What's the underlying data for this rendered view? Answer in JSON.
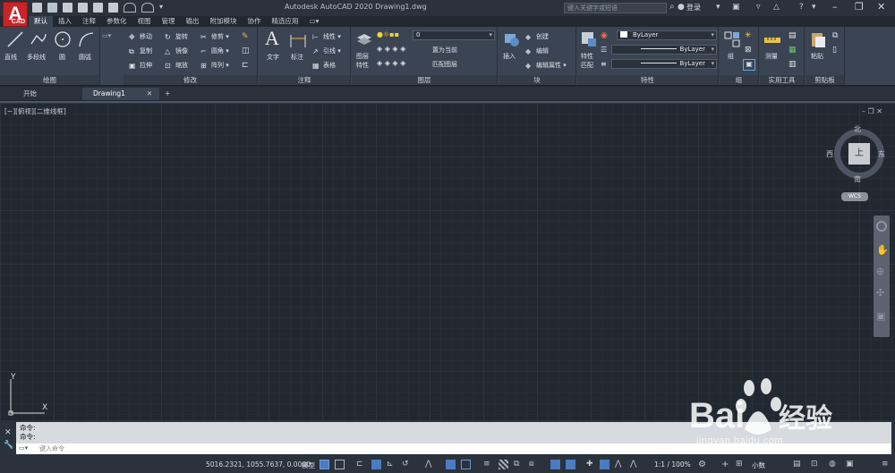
{
  "titlebar": {
    "app_title": "Autodesk AutoCAD 2020    Drawing1.dwg",
    "search_placeholder": "键入关键字或短语",
    "sign_in": "登录",
    "logo_letter": "A",
    "logo_sub": "CAD"
  },
  "ribbon_tabs": [
    "默认",
    "插入",
    "注释",
    "参数化",
    "视图",
    "管理",
    "输出",
    "附加模块",
    "协作",
    "精选应用"
  ],
  "active_tab": "默认",
  "ribbon": {
    "draw": {
      "title": "绘图",
      "line": "直线",
      "polyline": "多段线",
      "circle": "圆",
      "arc": "圆弧"
    },
    "modify": {
      "title": "修改",
      "move": "移动",
      "rotate": "旋转",
      "trim": "修剪",
      "copy": "复制",
      "mirror": "镜像",
      "fillet": "圆角",
      "stretch": "拉伸",
      "scale": "缩放",
      "array": "阵列"
    },
    "annotation": {
      "title": "注释",
      "text": "文字",
      "dimension": "标注",
      "linear": "线性",
      "leader": "引线",
      "table": "表格"
    },
    "layers": {
      "title": "图层",
      "layer_props_1": "图层",
      "layer_props_2": "特性",
      "layer_value": "0",
      "make_current": "置为当前",
      "match_layer": "匹配图层"
    },
    "block": {
      "title": "块",
      "insert": "插入",
      "create": "创建",
      "edit": "编辑",
      "edit_attr": "编辑属性"
    },
    "properties": {
      "title": "特性",
      "match_1": "特性",
      "match_2": "匹配",
      "color": "ByLayer",
      "linetype": "ByLayer",
      "lineweight": "ByLayer"
    },
    "groups": {
      "title": "组",
      "group": "组"
    },
    "utilities": {
      "title": "实用工具",
      "measure": "测量"
    },
    "clipboard": {
      "title": "剪贴板",
      "paste": "粘贴"
    }
  },
  "file_tabs": {
    "start": "开始",
    "drawing": "Drawing1"
  },
  "canvas": {
    "viewport_label": "[−][俯视][二维线框]",
    "viewcube_top": "上",
    "compass_n": "北",
    "compass_s": "南",
    "compass_e": "东",
    "compass_w": "西",
    "wcs": "WCS",
    "ucs_x": "X",
    "ucs_y": "Y"
  },
  "command": {
    "history": [
      "命令:",
      "命令:"
    ],
    "placeholder": "键入命令"
  },
  "status": {
    "coords": "5016.2321, 1055.7637, 0.0000",
    "model": "模型",
    "scale": "1:1 / 100%",
    "units": "小数"
  },
  "watermark": {
    "logo_text": "Bai 经验",
    "url": "jingyan.baidu.com"
  }
}
